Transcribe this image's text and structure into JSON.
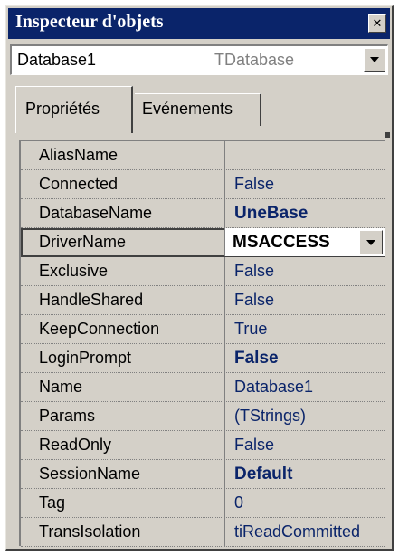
{
  "window": {
    "title": "Inspecteur d'objets",
    "close_glyph": "✕"
  },
  "object_selector": {
    "name": "Database1",
    "type": "TDatabase"
  },
  "tabs": [
    {
      "label": "Propriétés",
      "active": true
    },
    {
      "label": "Evénements",
      "active": false
    }
  ],
  "properties": [
    {
      "name": "AliasName",
      "value": "",
      "bold": false
    },
    {
      "name": "Connected",
      "value": "False",
      "bold": false
    },
    {
      "name": "DatabaseName",
      "value": "UneBase",
      "bold": true
    },
    {
      "name": "DriverName",
      "value": "MSACCESS",
      "bold": true,
      "selected": true
    },
    {
      "name": "Exclusive",
      "value": "False",
      "bold": false
    },
    {
      "name": "HandleShared",
      "value": "False",
      "bold": false
    },
    {
      "name": "KeepConnection",
      "value": "True",
      "bold": false
    },
    {
      "name": "LoginPrompt",
      "value": "False",
      "bold": true
    },
    {
      "name": "Name",
      "value": "Database1",
      "bold": false
    },
    {
      "name": "Params",
      "value": "(TStrings)",
      "bold": false
    },
    {
      "name": "ReadOnly",
      "value": "False",
      "bold": false
    },
    {
      "name": "SessionName",
      "value": "Default",
      "bold": true
    },
    {
      "name": "Tag",
      "value": "0",
      "bold": false
    },
    {
      "name": "TransIsolation",
      "value": "tiReadCommitted",
      "bold": false
    }
  ],
  "colors": {
    "titlebar": "#0a246a",
    "face": "#d4d0c8",
    "value_text": "#0a246a"
  },
  "icons": {
    "close": "close-icon",
    "dropdown": "chevron-down-icon"
  }
}
